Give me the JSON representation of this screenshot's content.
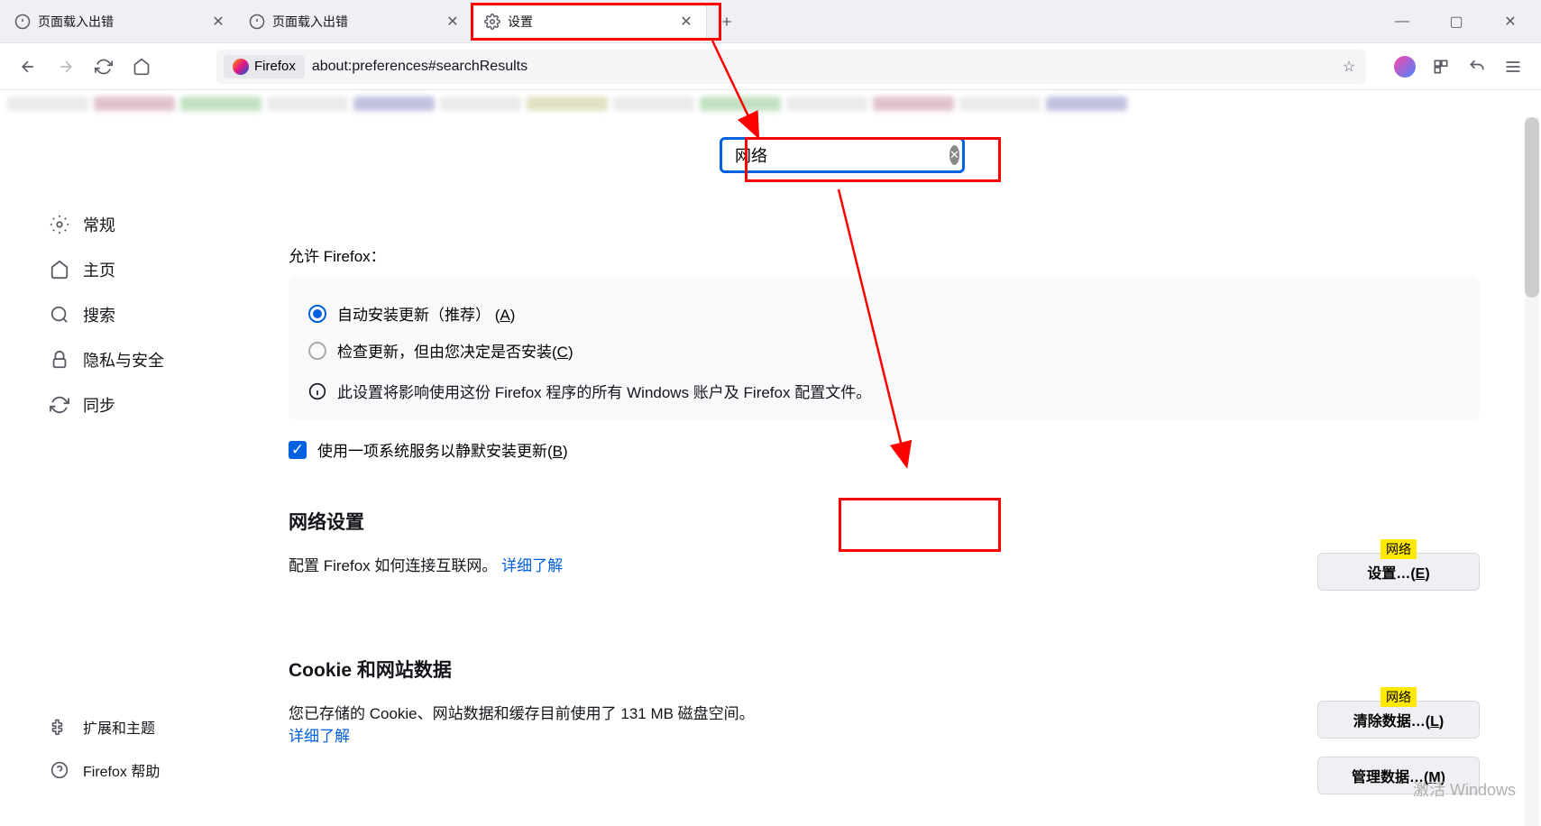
{
  "tabs": [
    {
      "title": "页面载入出错",
      "icon": "info"
    },
    {
      "title": "页面载入出错",
      "icon": "info"
    },
    {
      "title": "设置",
      "icon": "gear",
      "active": true
    }
  ],
  "url": {
    "chip": "Firefox",
    "path": "about:preferences#searchResults"
  },
  "sidebar": {
    "general": "常规",
    "home": "主页",
    "search": "搜索",
    "privacy": "隐私与安全",
    "sync": "同步",
    "extensions": "扩展和主题",
    "help": "Firefox 帮助"
  },
  "searchbox": {
    "value": "网络"
  },
  "sections": {
    "updates": {
      "allow": "允许 Firefox：",
      "auto": "自动安装更新（推荐）",
      "auto_key": "A",
      "check": "检查更新，但由您决定是否安装",
      "check_key": "C",
      "info": "此设置将影响使用这份 Firefox 程序的所有 Windows 账户及 Firefox 配置文件。",
      "silent": "使用一项系统服务以静默安装更新",
      "silent_key": "B"
    },
    "network": {
      "title": "网络设置",
      "desc": "配置 Firefox 如何连接互联网。",
      "learn": "详细了解",
      "btn": "设置…",
      "btn_key": "E",
      "tag": "网络"
    },
    "cookies": {
      "title": "Cookie 和网站数据",
      "desc": "您已存储的 Cookie、网站数据和缓存目前使用了 131 MB 磁盘空间。",
      "learn": "详细了解",
      "clear": "清除数据…",
      "clear_key": "L",
      "manage": "管理数据…",
      "manage_key": "M",
      "tag": "网络"
    }
  },
  "watermark": "激活 Windows"
}
